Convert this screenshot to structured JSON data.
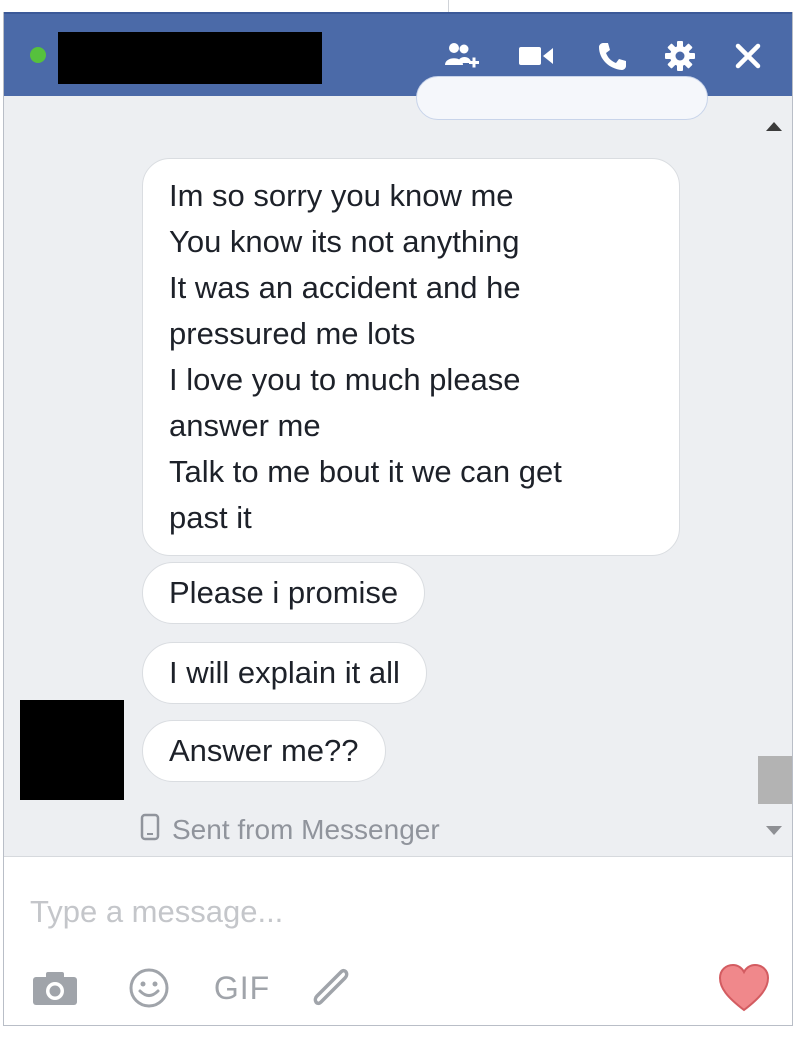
{
  "header": {
    "icons": [
      "add-people-icon",
      "video-call-icon",
      "phone-call-icon",
      "settings-gear-icon",
      "close-icon"
    ],
    "status_color": "#56c13d",
    "background_color": "#4b6aa8"
  },
  "messages": [
    {
      "lines": [
        "Im so sorry you know me",
        "You know its not anything",
        "It was an accident and he",
        "pressured me lots",
        "I love you to much please",
        "answer me",
        "Talk to me bout it we can get",
        "past it"
      ]
    },
    {
      "text": "Please i promise"
    },
    {
      "text": "I will explain it all"
    },
    {
      "text": "Answer me??"
    }
  ],
  "sent_from": "Sent from Messenger",
  "composer": {
    "placeholder": "Type a message...",
    "gif_label": "GIF",
    "icons": [
      "camera-icon",
      "emoji-icon",
      "gif-icon",
      "attachment-icon",
      "heart-icon"
    ],
    "heart_color": "#f0888b"
  }
}
